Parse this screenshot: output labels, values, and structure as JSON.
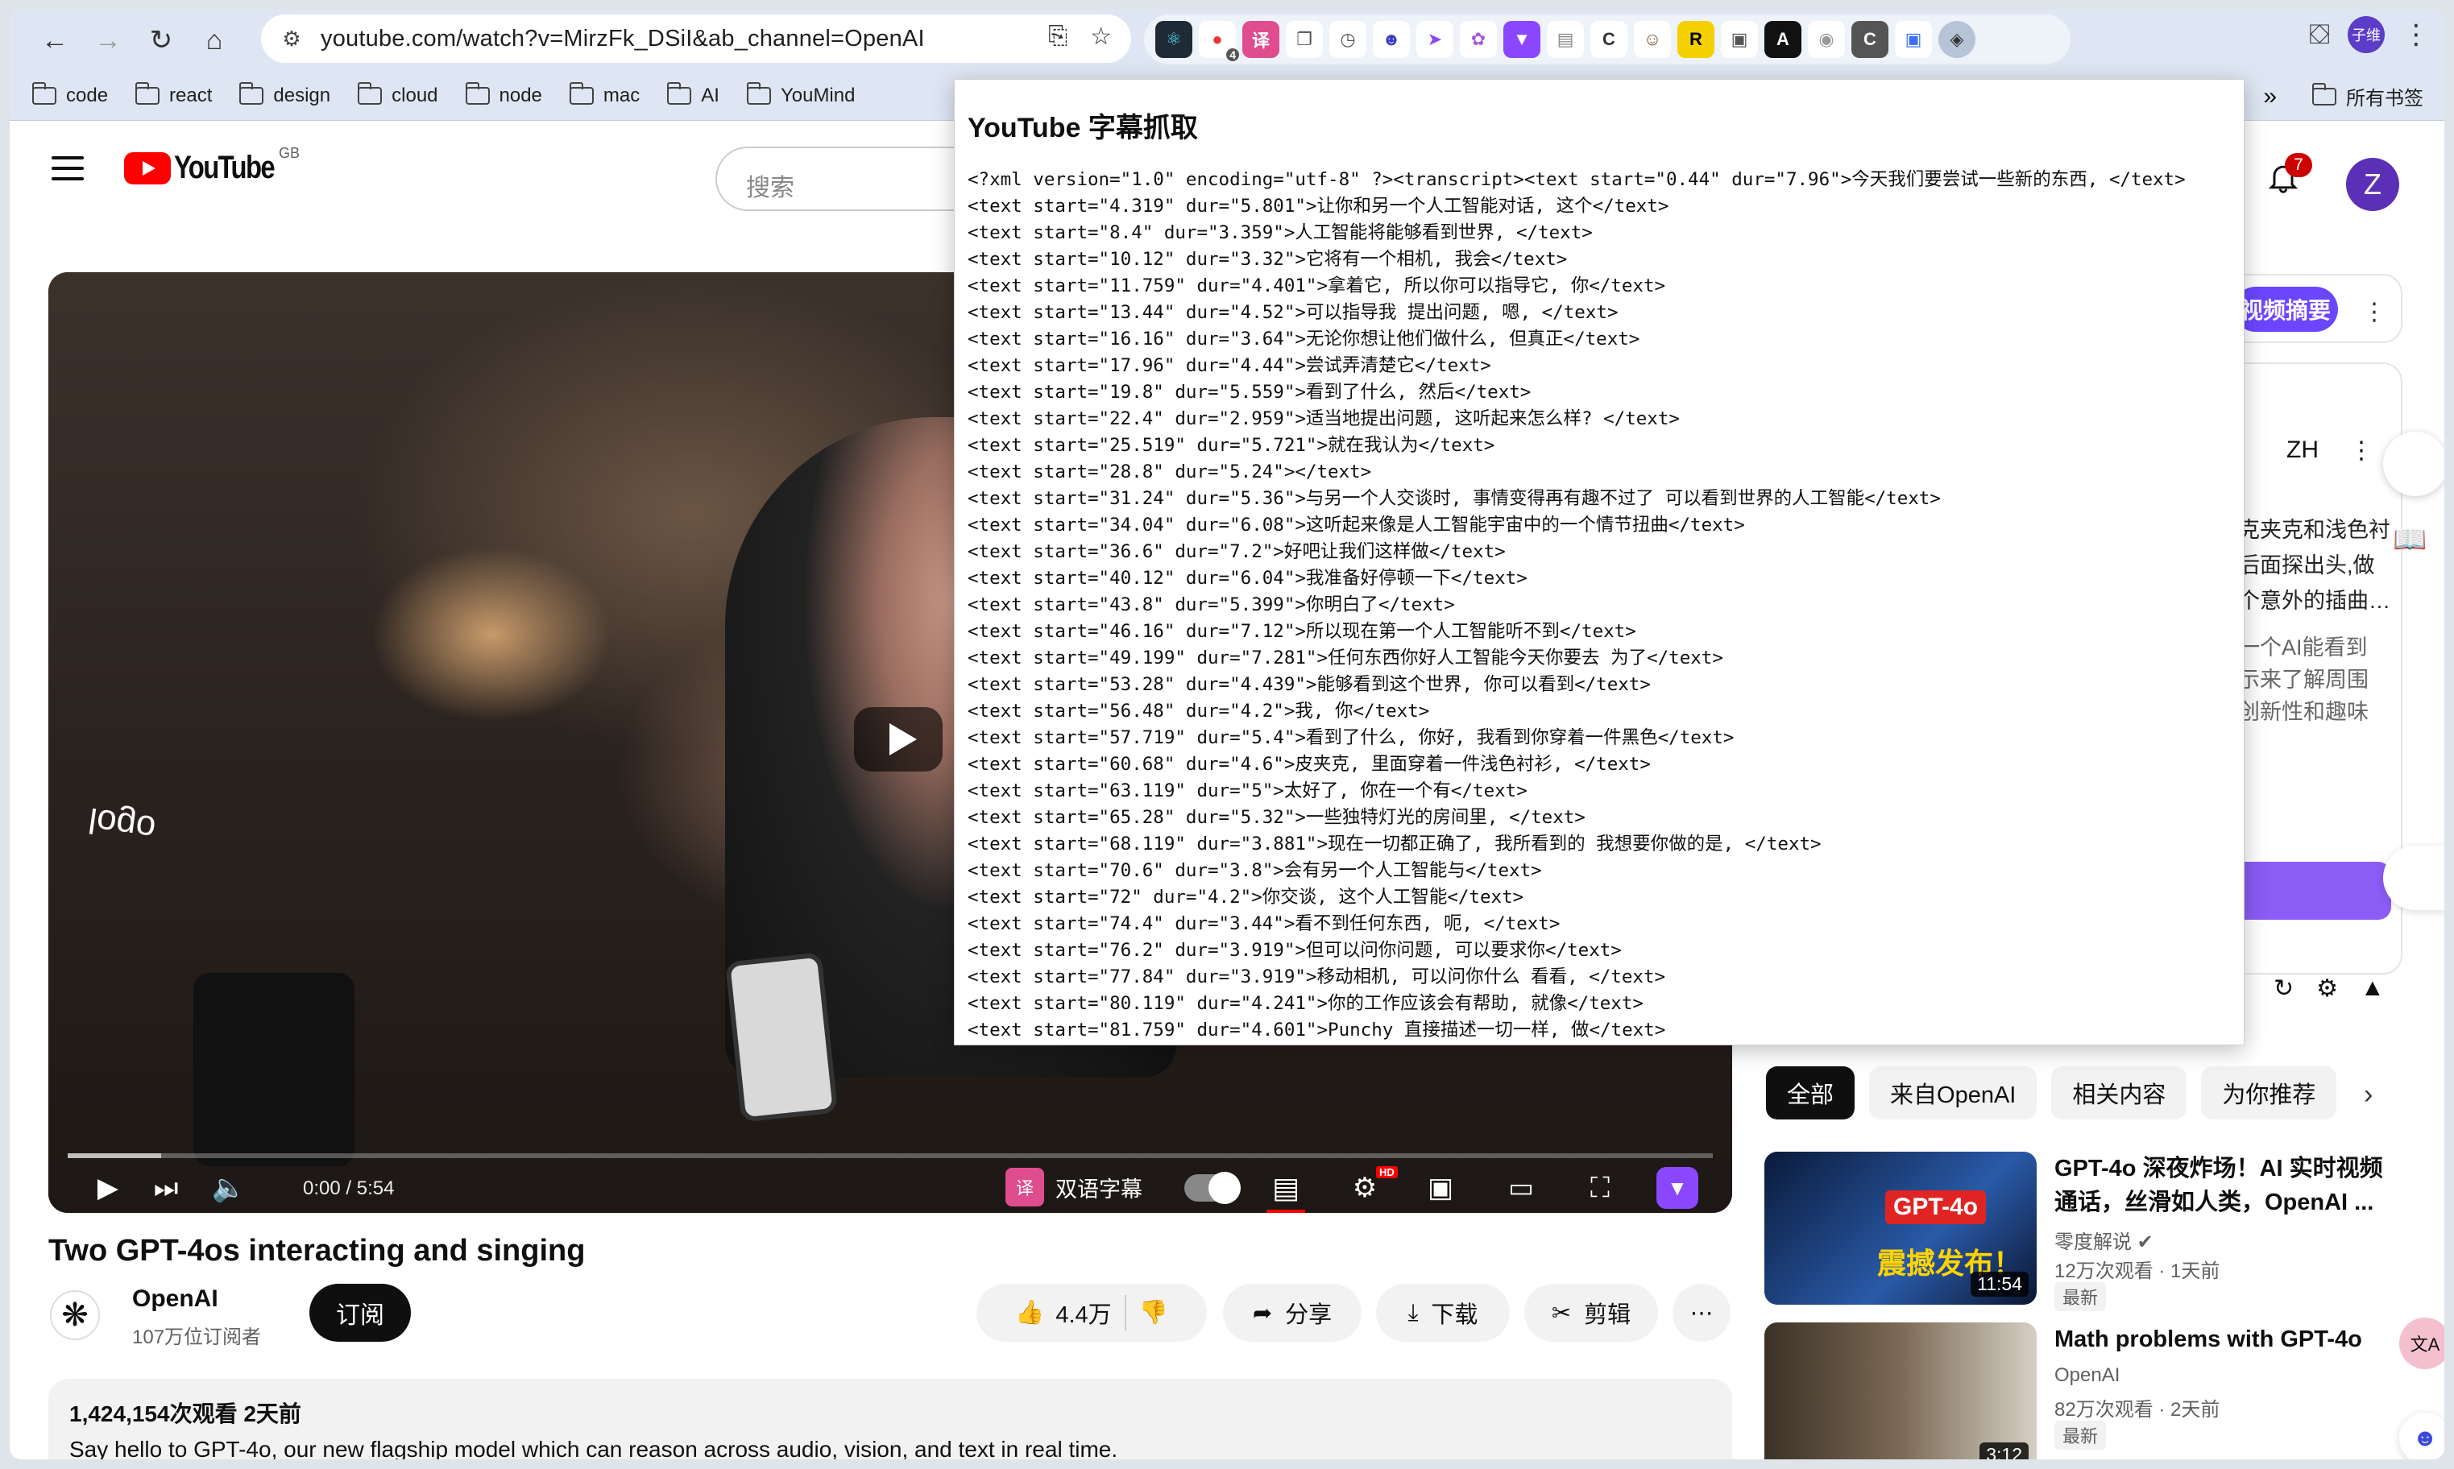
{
  "browser": {
    "url": "youtube.com/watch?v=MirzFk_DSiI&ab_channel=OpenAI",
    "ext_badge": "4",
    "profile_label": "子维",
    "bookmarks": [
      "code",
      "react",
      "design",
      "cloud",
      "node",
      "mac",
      "AI",
      "YouMind"
    ],
    "bookmarks_all": "所有书签",
    "more": "»"
  },
  "youtube": {
    "logo": "YouTube",
    "region": "GB",
    "search_placeholder": "搜索",
    "notif_count": "7",
    "avatar_letter": "Z"
  },
  "video": {
    "overlay_text": "logo",
    "time": "0:00 / 5:54",
    "dual_subtitle_label": "双语字幕",
    "dual_subtitle_icon": "译",
    "progress_loaded": 0.057,
    "hd": "HD"
  },
  "info": {
    "title": "Two GPT-4os interacting and singing",
    "channel": "OpenAI",
    "subs": "107万位订阅者",
    "subscribe": "订阅",
    "likes": "4.4万",
    "share": "分享",
    "download": "下载",
    "clip": "剪辑",
    "more": "⋯",
    "meta": "1,424,154次观看  2天前",
    "description": "Say hello to GPT-4o, our new flagship model which can reason across audio, vision, and text in real time."
  },
  "sidebar": {
    "summary_btn": "视频摘要",
    "lang": "ZH",
    "snippet_a": [
      "克夹克和浅色衬",
      "后面探出头,做",
      "个意外的插曲…"
    ],
    "snippet_b": [
      "一个AI能看到",
      "示来了解周围",
      "创新性和趣味"
    ],
    "chips": [
      "全部",
      "来自OpenAI",
      "相关内容",
      "为你推荐"
    ],
    "recs": [
      {
        "title": "GPT-4o 深夜炸场！AI 实时视频通话，丝滑如人类，OpenAI ...",
        "channel": "零度解说 ✔",
        "views": "12万次观看 · 1天前",
        "badge": "最新",
        "duration": "11:54",
        "thumb_caption": "GPT-4o",
        "thumb_caption2": "震撼发布！"
      },
      {
        "title": "Math problems with GPT-4o",
        "channel": "OpenAI",
        "views": "82万次观看 · 2天前",
        "badge": "最新",
        "duration": "3:12"
      }
    ],
    "float_translate": "文A"
  },
  "popup": {
    "title": "YouTube 字幕抓取",
    "lines": [
      "<?xml version=\"1.0\" encoding=\"utf-8\" ?><transcript><text start=\"0.44\" dur=\"7.96\">今天我们要尝试一些新的东西, </text>",
      "<text start=\"4.319\" dur=\"5.801\">让你和另一个人工智能对话, 这个</text>",
      "<text start=\"8.4\" dur=\"3.359\">人工智能将能够看到世界, </text>",
      "<text start=\"10.12\" dur=\"3.32\">它将有一个相机, 我会</text>",
      "<text start=\"11.759\" dur=\"4.401\">拿着它, 所以你可以指导它, 你</text>",
      "<text start=\"13.44\" dur=\"4.52\">可以指导我 提出问题, 嗯, </text>",
      "<text start=\"16.16\" dur=\"3.64\">无论你想让他们做什么, 但真正</text>",
      "<text start=\"17.96\" dur=\"4.44\">尝试弄清楚它</text>",
      "<text start=\"19.8\" dur=\"5.559\">看到了什么, 然后</text>",
      "<text start=\"22.4\" dur=\"2.959\">适当地提出问题, 这听起来怎么样? </text>",
      "<text start=\"25.519\" dur=\"5.721\">就在我认为</text>",
      "<text start=\"28.8\" dur=\"5.24\"></text>",
      "<text start=\"31.24\" dur=\"5.36\">与另一个人交谈时, 事情变得再有趣不过了 可以看到世界的人工智能</text>",
      "<text start=\"34.04\" dur=\"6.08\">这听起来像是人工智能宇宙中的一个情节扭曲</text>",
      "<text start=\"36.6\" dur=\"7.2\">好吧让我们这样做</text>",
      "<text start=\"40.12\" dur=\"6.04\">我准备好停顿一下</text>",
      "<text start=\"43.8\" dur=\"5.399\">你明白了</text>",
      "<text start=\"46.16\" dur=\"7.12\">所以现在第一个人工智能听不到</text>",
      "<text start=\"49.199\" dur=\"7.281\">任何东西你好人工智能今天你要去 为了</text>",
      "<text start=\"53.28\" dur=\"4.439\">能够看到这个世界, 你可以看到</text>",
      "<text start=\"56.48\" dur=\"4.2\">我, 你</text>",
      "<text start=\"57.719\" dur=\"5.4\">看到了什么, 你好, 我看到你穿着一件黑色</text>",
      "<text start=\"60.68\" dur=\"4.6\">皮夹克, 里面穿着一件浅色衬衫, </text>",
      "<text start=\"63.119\" dur=\"5\">太好了, 你在一个有</text>",
      "<text start=\"65.28\" dur=\"5.32\">一些独特灯光的房间里, </text>",
      "<text start=\"68.119\" dur=\"3.881\">现在一切都正确了, 我所看到的 我想要你做的是, </text>",
      "<text start=\"70.6\" dur=\"3.8\">会有另一个人工智能与</text>",
      "<text start=\"72\" dur=\"4.2\">你交谈, 这个人工智能</text>",
      "<text start=\"74.4\" dur=\"3.44\">看不到任何东西, 呃, </text>",
      "<text start=\"76.2\" dur=\"3.919\">但可以问你问题, 可以要求你</text>",
      "<text start=\"77.84\" dur=\"3.919\">移动相机, 可以问你什么 看看, </text>",
      "<text start=\"80.119\" dur=\"4.241\">你的工作应该会有帮助, 就像</text>",
      "<text start=\"81.759\" dur=\"4.601\">Punchy 直接描述一切一样, 做</text>"
    ]
  }
}
